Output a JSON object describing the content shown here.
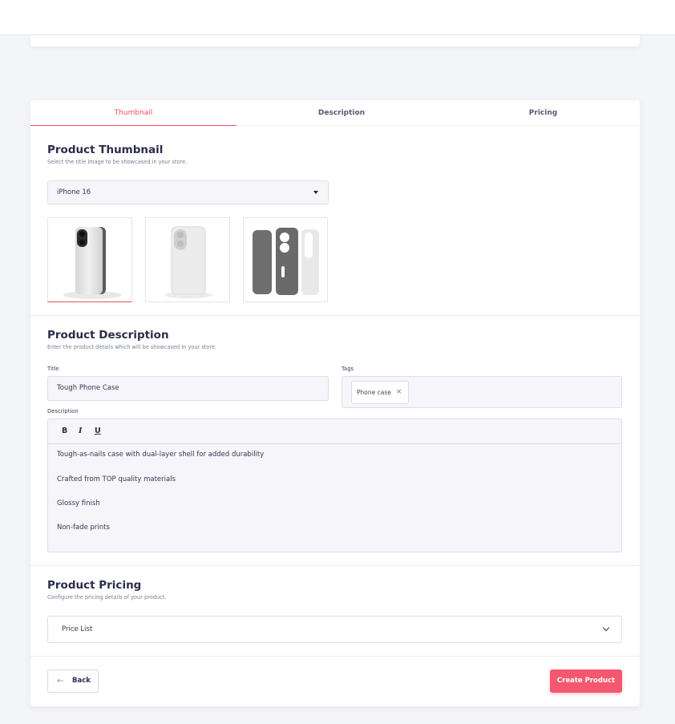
{
  "tabs": [
    {
      "label": "Thumbnail",
      "active": true
    },
    {
      "label": "Description",
      "active": false
    },
    {
      "label": "Pricing",
      "active": false
    }
  ],
  "thumbnail": {
    "heading": "Product Thumbnail",
    "subtitle": "Select the title image to be showcased in your store.",
    "model_select": "iPhone 16",
    "images": [
      "phone-case-back-angled",
      "phone-case-back-front",
      "phone-case-layers"
    ]
  },
  "description": {
    "heading": "Product Description",
    "subtitle": "Enter the product details which will be showcased in your store.",
    "title_label": "Title",
    "title_value": "Tough Phone Case",
    "tags_label": "Tags",
    "tags": [
      "Phone case"
    ],
    "tag_remove": "×",
    "description_label": "Description",
    "toolbar": {
      "bold": "B",
      "italic": "I",
      "underline": "U"
    },
    "paragraphs": [
      "Tough-as-nails case with dual-layer shell for added durability",
      "Crafted from TOP quality materials",
      "Glossy finish",
      "Non-fade prints"
    ]
  },
  "pricing": {
    "heading": "Product Pricing",
    "subtitle": "Configure the pricing details of your product.",
    "price_list": "Price List"
  },
  "footer": {
    "back_arrow": "←",
    "back_label": "Back",
    "create_label": "Create Product"
  },
  "colors": {
    "accent": "#f04a63",
    "button": "#f45770"
  }
}
